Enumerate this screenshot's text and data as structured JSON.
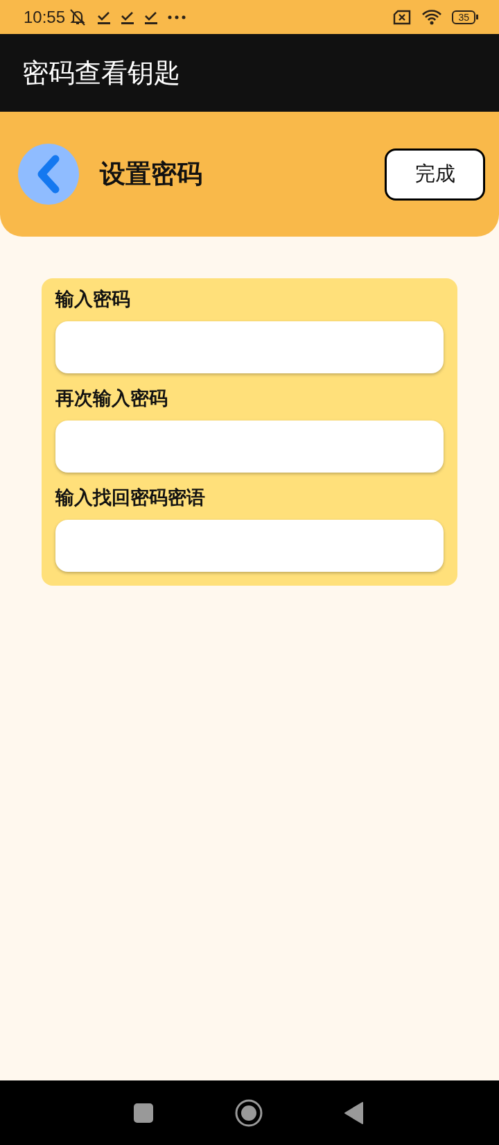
{
  "status_bar": {
    "time": "10:55",
    "battery": "35"
  },
  "app_bar": {
    "title": "密码查看钥匙"
  },
  "header": {
    "title": "设置密码",
    "done_button": "完成"
  },
  "form": {
    "fields": [
      {
        "label": "输入密码"
      },
      {
        "label": "再次输入密码"
      },
      {
        "label": "输入找回密码密语"
      }
    ]
  }
}
